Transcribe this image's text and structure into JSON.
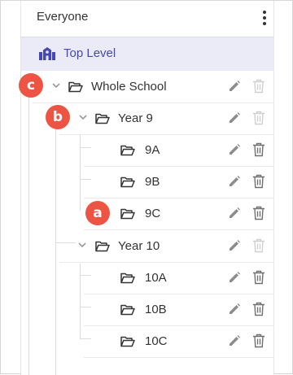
{
  "header": {
    "title": "Everyone"
  },
  "top_level": {
    "label": "Top Level"
  },
  "tree": {
    "whole_school": "Whole School",
    "year9": "Year 9",
    "class_9a": "9A",
    "class_9b": "9B",
    "class_9c": "9C",
    "year10": "Year 10",
    "class_10a": "10A",
    "class_10b": "10B",
    "class_10c": "10C"
  },
  "callouts": {
    "a": "a",
    "b": "b",
    "c": "c"
  },
  "colors": {
    "accent": "#4548b4",
    "top_level_bg": "#ebebf8",
    "callout": "#ec5444"
  }
}
